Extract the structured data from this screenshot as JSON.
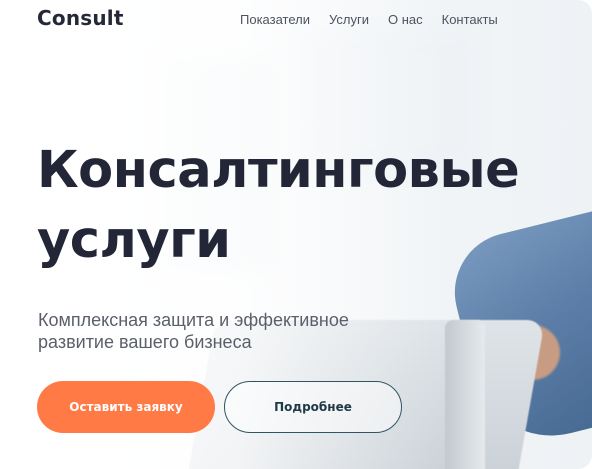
{
  "brand": {
    "logo": "Consult"
  },
  "nav": {
    "items": [
      {
        "label": "Показатели"
      },
      {
        "label": "Услуги"
      },
      {
        "label": "О нас"
      },
      {
        "label": "Контакты"
      }
    ]
  },
  "hero": {
    "title_line1": "Консалтинговые",
    "title_line2": "услуги",
    "subtitle": "Комплексная защита и эффективное развитие вашего бизнеса",
    "primary_button": "Оставить заявку",
    "secondary_button": "Подробнее"
  },
  "colors": {
    "accent": "#ff7a45",
    "heading": "#232637",
    "secondary_border": "#2f5560"
  }
}
